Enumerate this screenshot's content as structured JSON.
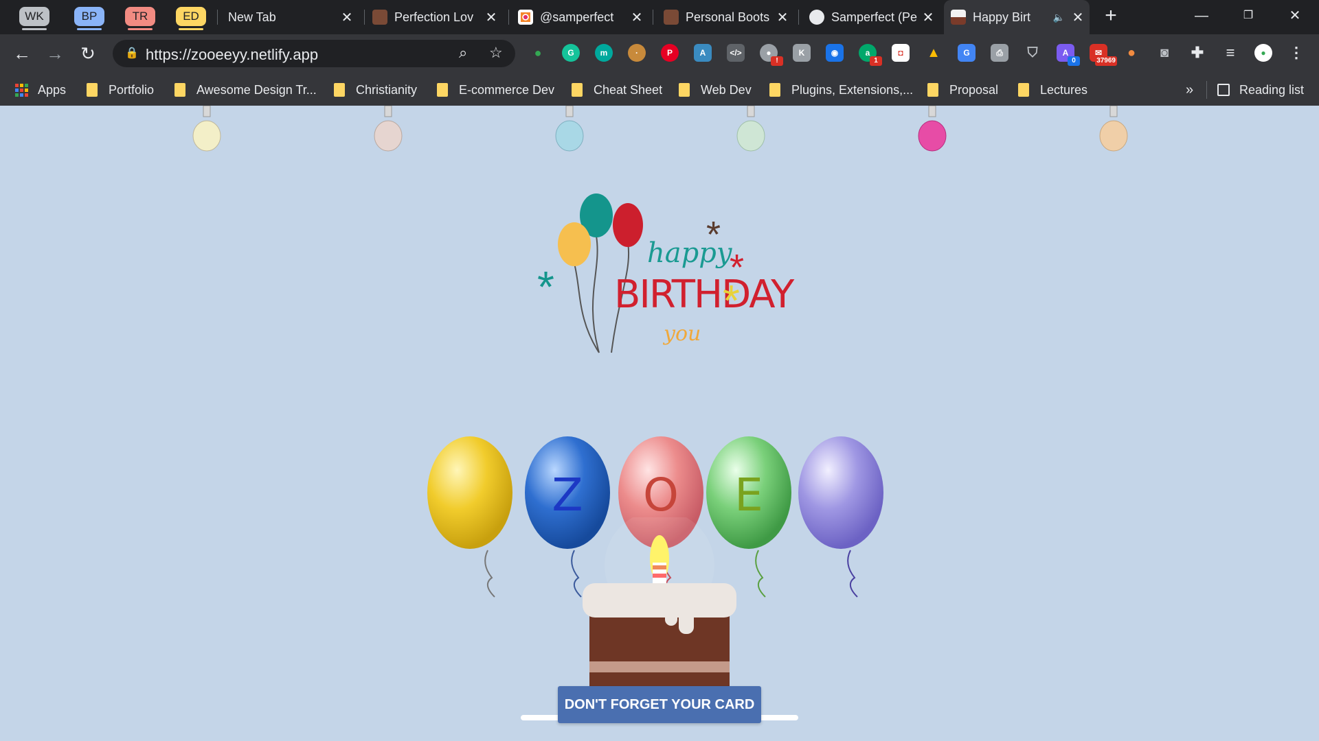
{
  "tab_groups": [
    {
      "label": "WK",
      "color": "#bdc1c6"
    },
    {
      "label": "BP",
      "color": "#8ab4f8"
    },
    {
      "label": "TR",
      "color": "#f28b82"
    },
    {
      "label": "ED",
      "color": "#fdd663"
    }
  ],
  "tabs": [
    {
      "title": "New Tab",
      "active": false
    },
    {
      "title": "Perfection Lov",
      "active": false
    },
    {
      "title": "@samperfect",
      "active": false
    },
    {
      "title": "Personal Boots",
      "active": false
    },
    {
      "title": "Samperfect (Pe",
      "active": false
    },
    {
      "title": "Happy Birt",
      "active": true
    }
  ],
  "toolbar": {
    "url": "https://zooeeyy.netlify.app",
    "back_icon": "back-arrow-icon",
    "forward_icon": "forward-arrow-icon",
    "reload_icon": "reload-icon",
    "extension_badges": [
      "1",
      "1",
      "0",
      "37969"
    ]
  },
  "bookmarks": {
    "apps": "Apps",
    "items": [
      "Portfolio",
      "Awesome Design Tr...",
      "Christianity",
      "E-commerce Dev",
      "Cheat Sheet",
      "Web Dev",
      "Plugins, Extensions,...",
      "Proposal",
      "Lectures"
    ],
    "more": "»",
    "reading_list": "Reading list"
  },
  "page": {
    "balloon_letters": [
      "Z",
      "O",
      "E"
    ],
    "greeting_line1": "happy",
    "greeting_line2": "BIRTHDAY",
    "greeting_line3": "you",
    "card_button": "DON'T FORGET YOUR CARD",
    "bulb_colors": [
      "#f3efc8",
      "#e6d5d0",
      "#a9d8e6",
      "#cfe6d5",
      "#e74ca6",
      "#f0cfa8"
    ],
    "balloon_colors": [
      "#f1cc2c",
      "#2f6fd0",
      "#ec8c8c",
      "#7ad07a",
      "#9f97e3"
    ]
  }
}
